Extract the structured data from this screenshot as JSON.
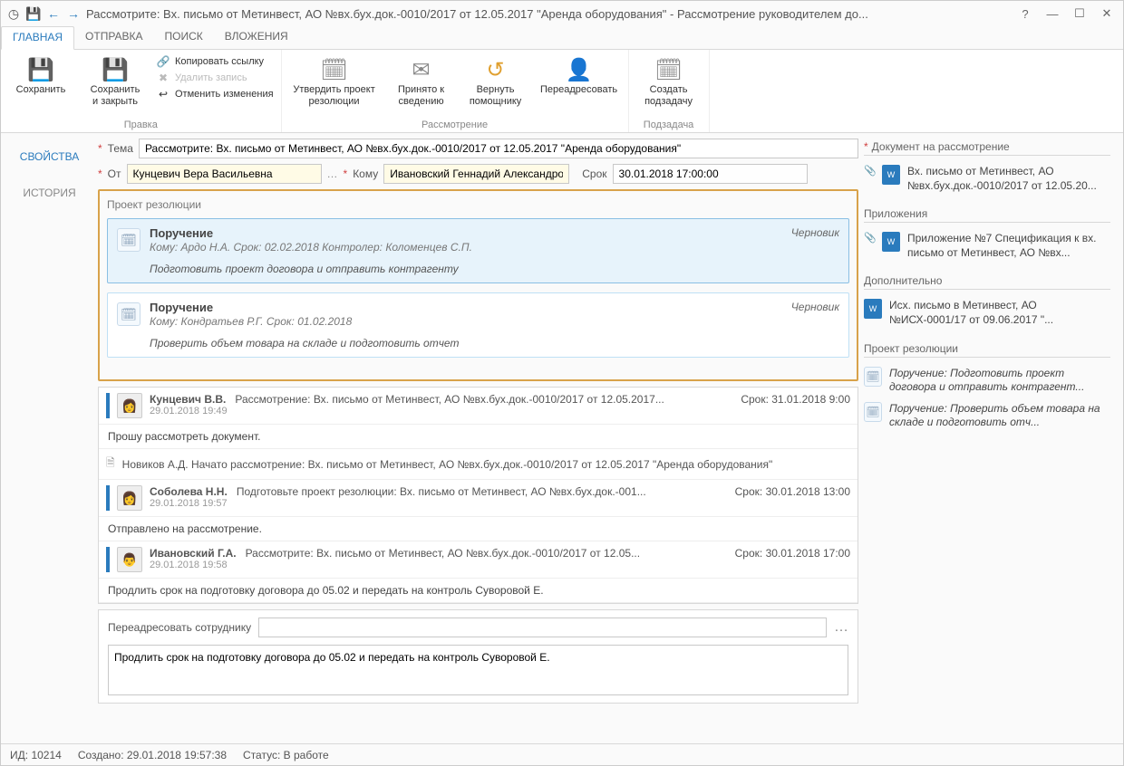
{
  "titlebar": {
    "title": "Рассмотрите: Вх. письмо от Метинвест, АО №вх.бух.док.-0010/2017 от 12.05.2017 \"Аренда оборудования\" - Рассмотрение руководителем до..."
  },
  "tabs": {
    "main": "ГЛАВНАЯ",
    "send": "ОТПРАВКА",
    "search": "ПОИСК",
    "attach": "ВЛОЖЕНИЯ"
  },
  "ribbon": {
    "save_group": {
      "save": "Сохранить",
      "save_close": "Сохранить\nи закрыть",
      "copy_link": "Копировать ссылку",
      "delete": "Удалить запись",
      "cancel_changes": "Отменить изменения",
      "label": "Правка"
    },
    "review_group": {
      "approve": "Утвердить проект\nрезолюции",
      "noted": "Принято к\nсведению",
      "return": "Вернуть\nпомощнику",
      "forward": "Переадресовать",
      "label": "Рассмотрение"
    },
    "subtask_group": {
      "create": "Создать\nподзадачу",
      "label": "Подзадача"
    }
  },
  "sidetabs": {
    "props": "СВОЙСТВА",
    "history": "ИСТОРИЯ"
  },
  "form": {
    "subject_lbl": "Тема",
    "subject_val": "Рассмотрите: Вх. письмо от Метинвест, АО №вх.бух.док.-0010/2017 от 12.05.2017 \"Аренда оборудования\"",
    "from_lbl": "От",
    "from_val": "Кунцевич Вера Васильевна",
    "to_lbl": "Кому",
    "to_val": "Ивановский Геннадий Александрови",
    "due_lbl": "Срок",
    "due_val": "30.01.2018 17:00:00"
  },
  "resolution": {
    "title": "Проект резолюции",
    "tasks": [
      {
        "title": "Поручение",
        "meta": "Кому: Ардо Н.А. Срок: 02.02.2018 Контролер: Коломенцев С.П.",
        "text": "Подготовить проект договора и отправить контрагенту",
        "status": "Черновик"
      },
      {
        "title": "Поручение",
        "meta": "Кому: Кондратьев Р.Г. Срок: 01.02.2018",
        "text": "Проверить объем товара на складе и подготовить отчет",
        "status": "Черновик"
      }
    ]
  },
  "feed": [
    {
      "who": "Кунцевич В.В.",
      "task": "Рассмотрение: Вх. письмо от Метинвест, АО №вх.бух.док.-0010/2017 от 12.05.2017...",
      "meta": "Срок: 31.01.2018 9:00",
      "ts": "29.01.2018 19:49",
      "msg": "Прошу рассмотреть документ.",
      "bar": "#2a7bbd"
    },
    {
      "line": "Новиков А.Д. Начато рассмотрение: Вх. письмо от Метинвест, АО №вх.бух.док.-0010/2017 от 12.05.2017 \"Аренда оборудования\""
    },
    {
      "who": "Соболева Н.Н.",
      "task": "Подготовьте проект резолюции: Вх. письмо от Метинвест, АО №вх.бух.док.-001...",
      "meta": "Срок: 30.01.2018 13:00",
      "ts": "29.01.2018 19:57",
      "msg": "Отправлено на рассмотрение.",
      "bar": "#2a7bbd"
    },
    {
      "who": "Ивановский Г.А.",
      "task": "Рассмотрите: Вх. письмо от Метинвест, АО №вх.бух.док.-0010/2017 от 12.05...",
      "meta": "Срок: 30.01.2018 17:00",
      "ts": "29.01.2018 19:58",
      "msg": "Продлить срок на подготовку договора до 05.02 и передать на контроль Суворовой Е.",
      "bar": "#2a7bbd"
    }
  ],
  "bottom": {
    "fwd_label": "Переадресовать сотруднику",
    "comment": "Продлить срок на подготовку договора до 05.02 и передать на контроль Суворовой Е."
  },
  "right": {
    "doc_title": "Документ на рассмотрение",
    "doc_item": "Вх. письмо от Метинвест, АО №вх.бух.док.-0010/2017 от 12.05.20...",
    "att_title": "Приложения",
    "att_item": "Приложение №7 Спецификация к вх. письмо от Метинвест, АО №вх...",
    "extra_title": "Дополнительно",
    "extra_item": "Исх. письмо в Метинвест, АО №ИСХ-0001/17 от 09.06.2017 \"...",
    "res_title": "Проект резолюции",
    "res_items": [
      "Поручение: Подготовить проект договора и отправить контрагент...",
      "Поручение: Проверить объем товара на складе и подготовить отч..."
    ]
  },
  "status": {
    "id_lbl": "ИД:",
    "id_val": "10214",
    "created_lbl": "Создано:",
    "created_val": "29.01.2018 19:57:38",
    "status_lbl": "Статус:",
    "status_val": "В работе"
  }
}
